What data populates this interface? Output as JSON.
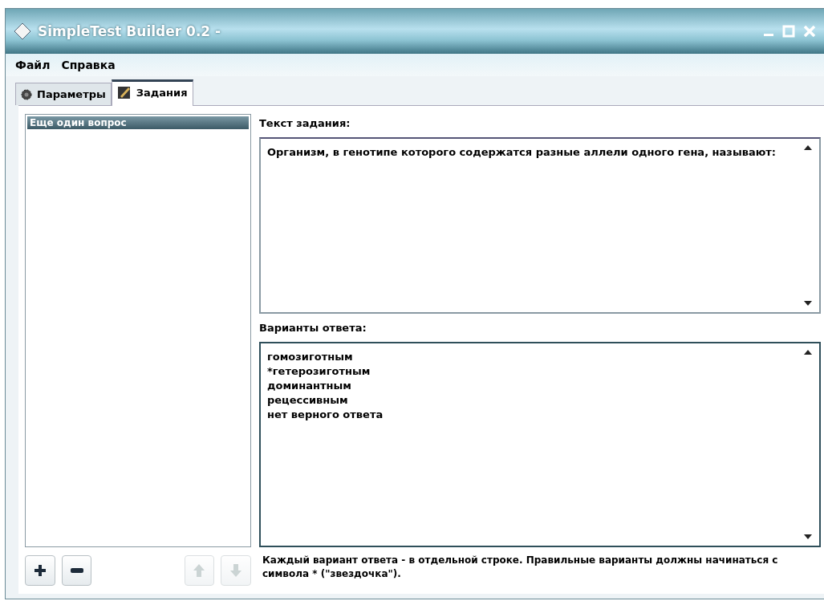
{
  "window": {
    "title": "SimpleTest Builder 0.2 -"
  },
  "menu": [
    "Файл",
    "Справка"
  ],
  "tabs": [
    {
      "label": "Параметры",
      "kind": "gear",
      "selected": false
    },
    {
      "label": "Задания",
      "kind": "pencil",
      "selected": true
    }
  ],
  "questions": [
    {
      "label": "Еще один вопрос",
      "selected": true
    }
  ],
  "question_text": {
    "label": "Текст задания:",
    "value": "Организм, в генотипе которого содержатся разные аллели одного гена, называют:"
  },
  "answers": {
    "label": "Варианты ответа:",
    "lines": [
      "гомозиготным",
      "*гетерозиготным",
      "доминантным",
      "рецессивным",
      "нет верного ответа"
    ]
  },
  "buttons": [
    {
      "kind": "add",
      "disabled": false
    },
    {
      "kind": "remove",
      "disabled": false
    },
    {
      "kind": "up",
      "disabled": true
    },
    {
      "kind": "down",
      "disabled": true
    }
  ],
  "hint": "Каждый вариант ответа - в отдельной строке. Правильные варианты должны начинаться с символа * (\"звездочка\")."
}
